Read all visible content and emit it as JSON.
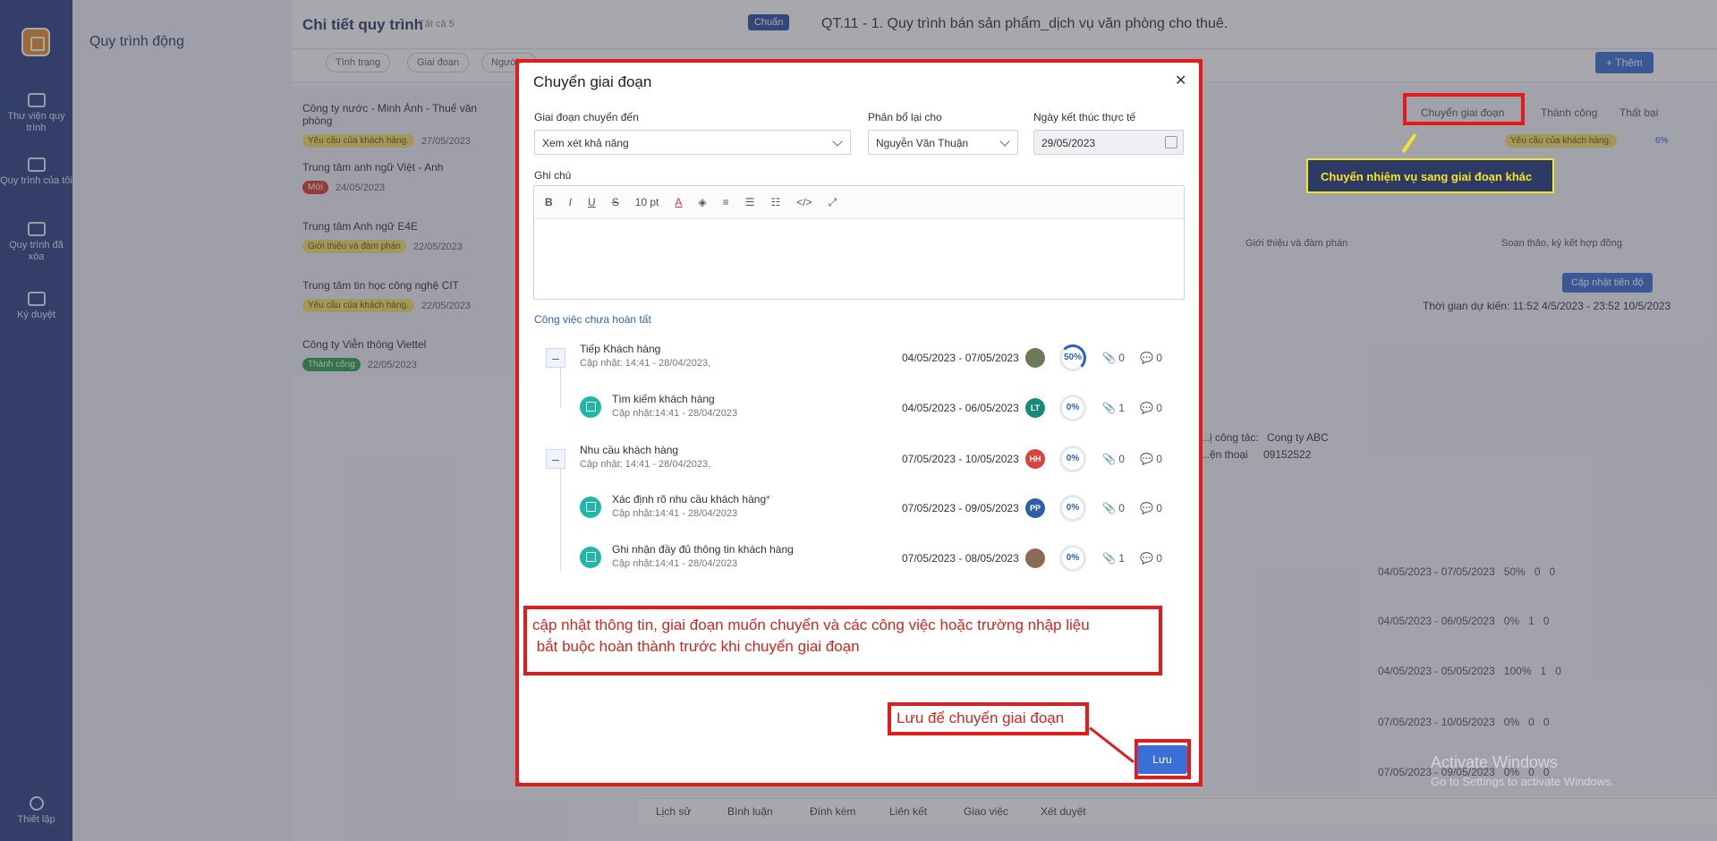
{
  "left_rail": {
    "items": [
      {
        "label": "Thư viện quy trình",
        "icon": "process-library-icon"
      },
      {
        "label": "Quy trình của tôi",
        "icon": "my-process-icon"
      },
      {
        "label": "Quy trình đã xóa",
        "icon": "deleted-process-icon"
      },
      {
        "label": "Ký duyệt",
        "icon": "approve-icon"
      }
    ],
    "settings": "Thiết lập"
  },
  "sidebar_title": "Quy trình động",
  "header": {
    "title": "Chi tiết quy trình",
    "count": "Tất cả 5",
    "badge": "Chuẩn",
    "doc_title": "QT.11 - 1. Quy trình bán sản phẩm_dịch vụ văn phòng cho thuê.",
    "add_button": "+ Thêm"
  },
  "filters": [
    "Tình trạng",
    "Giai đoạn",
    "Người..."
  ],
  "list": [
    {
      "name": "Công ty nước - Minh Ánh - Thuế văn phòng",
      "tag": "Yêu cầu của khách hàng.",
      "tag_type": "y",
      "date": "27/05/2023"
    },
    {
      "name": "Trung tâm anh ngữ Việt - Anh",
      "tag": "Mới",
      "tag_type": "r",
      "date": "24/05/2023"
    },
    {
      "name": "Trung tâm Anh ngữ E4E",
      "tag": "Giới thiệu và đàm phán",
      "tag_type": "y",
      "date": "22/05/2023"
    },
    {
      "name": "Trung tâm tin học công nghệ CIT",
      "tag": "Yêu cầu của khách hàng.",
      "tag_type": "y",
      "date": "22/05/2023"
    },
    {
      "name": "Công ty Viễn thông Viettel",
      "tag": "Thành công",
      "tag_type": "g",
      "date": "22/05/2023"
    }
  ],
  "detail_actions": {
    "move_stage": "Chuyển giai đoạn",
    "success": "Thành công",
    "fail": "Thất bại",
    "stage_tag": "Yêu cầu của khách hàng.",
    "progress": "6%",
    "stage_steps": [
      "Giới thiệu và đàm phán",
      "Soạn thảo, ký kết hợp đồng"
    ],
    "update_progress": "Cập nhật tiến độ",
    "expected_time": "Thời gian dự kiến: 11:52 4/5/2023 - 23:52 10/5/2023",
    "partner_label": "...ị công tác:",
    "partner_value": "Cong ty ABC",
    "phone_label": "...ện thoại",
    "phone_value": "09152522"
  },
  "bg_tasks": [
    {
      "dates": "04/05/2023 - 07/05/2023",
      "pct": "50%",
      "att": "0",
      "cmt": "0"
    },
    {
      "dates": "04/05/2023 - 06/05/2023",
      "pct": "0%",
      "att": "1",
      "cmt": "0"
    },
    {
      "dates": "04/05/2023 - 05/05/2023",
      "pct": "100%",
      "att": "1",
      "cmt": "0"
    },
    {
      "dates": "07/05/2023 - 10/05/2023",
      "pct": "0%",
      "att": "0",
      "cmt": "0"
    },
    {
      "dates": "07/05/2023 - 09/05/2023",
      "pct": "0%",
      "att": "0",
      "cmt": "0"
    }
  ],
  "bottom_tabs": [
    "Lịch sử",
    "Bình luận",
    "Đính kèm",
    "Liên kết",
    "Giao việc",
    "Xét duyệt"
  ],
  "modal": {
    "title": "Chuyển giai đoạn",
    "stage_label": "Giai đoạn chuyển đến",
    "stage_value": "Xem xét khả năng",
    "assign_label": "Phân bổ lại cho",
    "assign_value": "Nguyễn Văn Thuận",
    "end_label": "Ngày kết thúc thực tế",
    "end_value": "29/05/2023",
    "note_label": "Ghi chú",
    "font_size": "10 pt",
    "pending_title": "Công việc chưa hoàn tất",
    "tasks": [
      {
        "name": "Tiếp Khách hàng",
        "updated": "Cập nhật: 14:41 - 28/04/2023,",
        "dates": "04/05/2023 - 07/05/2023",
        "avatar": "",
        "avatar_color": "#6b7b56",
        "pct": "50%",
        "att": "0",
        "cmt": "0",
        "level": 0
      },
      {
        "name": "Tìm kiếm khách hàng",
        "updated": "Cập nhật:14:41 - 28/04/2023",
        "dates": "04/05/2023 - 06/05/2023",
        "avatar": "LT",
        "avatar_color": "#178a7a",
        "pct": "0%",
        "att": "1",
        "cmt": "0",
        "level": 1
      },
      {
        "name": "Nhu cầu khách hàng",
        "updated": "Cập nhật: 14:41 - 28/04/2023,",
        "dates": "07/05/2023 - 10/05/2023",
        "avatar": "HH",
        "avatar_color": "#d9443b",
        "pct": "0%",
        "att": "0",
        "cmt": "0",
        "level": 0
      },
      {
        "name": "Xác định rõ nhu cầu khách hàng",
        "updated": "Cập nhật:14:41 - 28/04/2023",
        "dates": "07/05/2023 - 09/05/2023",
        "avatar": "PP",
        "avatar_color": "#2d5fa8",
        "pct": "0%",
        "att": "0",
        "cmt": "0",
        "level": 1,
        "required": "*"
      },
      {
        "name": "Ghi nhận đầy đủ thông tin khách hàng",
        "updated": "Cập nhật:14:41 - 28/04/2023",
        "dates": "07/05/2023 - 08/05/2023",
        "avatar": "",
        "avatar_color": "#8a6a55",
        "pct": "0%",
        "att": "1",
        "cmt": "0",
        "level": 1
      }
    ],
    "save": "Lưu"
  },
  "annotations": {
    "move_hint": "Chuyển nhiệm vụ sang giai đoạn khác",
    "info_line1": "cập nhật thông tin, giai đoạn muốn chuyển và các công việc hoặc trường nhập liệu",
    "info_line2": "bắt buộc hoàn thành trước khi chuyển giai đoạn",
    "save_hint": "Lưu để chuyển giai đoạn"
  },
  "watermark": {
    "line1": "Activate Windows",
    "line2": "Go to Settings to activate Windows."
  },
  "colors": {
    "accent": "#3b6fd8",
    "annotation_red": "#e41b1b",
    "rail": "#2d4186",
    "hint_yellow": "#f4e526"
  }
}
